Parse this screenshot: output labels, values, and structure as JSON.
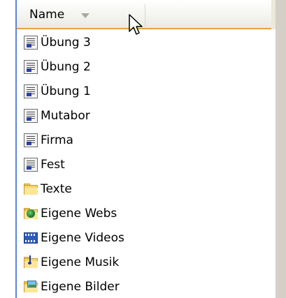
{
  "header": {
    "column_label": "Name",
    "sort_icon": "sort-descending-icon"
  },
  "colors": {
    "header_underline": "#e9a23b",
    "left_rule": "#5a86d6"
  },
  "files": [
    {
      "label": "Übung 3",
      "icon": "document-icon"
    },
    {
      "label": "Übung 2",
      "icon": "document-icon"
    },
    {
      "label": "Übung 1",
      "icon": "document-icon"
    },
    {
      "label": "Mutabor",
      "icon": "document-icon"
    },
    {
      "label": "Firma",
      "icon": "document-icon"
    },
    {
      "label": "Fest",
      "icon": "document-icon"
    },
    {
      "label": "Texte",
      "icon": "folder-icon"
    },
    {
      "label": "Eigene Webs",
      "icon": "web-folder-icon"
    },
    {
      "label": "Eigene Videos",
      "icon": "video-folder-icon"
    },
    {
      "label": "Eigene Musik",
      "icon": "music-folder-icon"
    },
    {
      "label": "Eigene Bilder",
      "icon": "pictures-folder-icon"
    }
  ]
}
